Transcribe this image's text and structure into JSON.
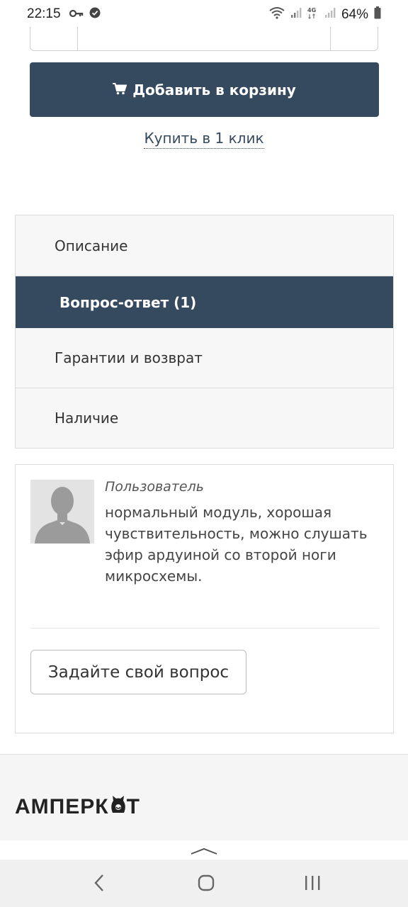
{
  "status_bar": {
    "time": "22:15",
    "battery": "64%",
    "icons": [
      "key-icon",
      "check-circle-icon",
      "wifi-icon",
      "signal-icon",
      "signal-4g-icon",
      "signal-icon",
      "battery-icon"
    ]
  },
  "product": {
    "add_to_cart_label": "Добавить в корзину",
    "buy_one_click_label": "Купить в 1 клик"
  },
  "tabs": [
    {
      "label": "Описание",
      "active": false
    },
    {
      "label": "Вопрос-ответ (1)",
      "active": true
    },
    {
      "label": "Гарантии и возврат",
      "active": false
    },
    {
      "label": "Наличие",
      "active": false
    }
  ],
  "qa": {
    "reviews": [
      {
        "author": "Пользователь",
        "text": "нормальный модуль, хорошая чувствительность, можно слушать эфир ардуиной со второй ноги микросхемы."
      }
    ],
    "ask_button_label": "Задайте свой вопрос"
  },
  "footer": {
    "logo_text": "АМПЕРК",
    "logo_suffix": "Т"
  },
  "colors": {
    "accent": "#354a5f",
    "panel_bg": "#f7f7f7",
    "border": "#dcdcdc"
  }
}
